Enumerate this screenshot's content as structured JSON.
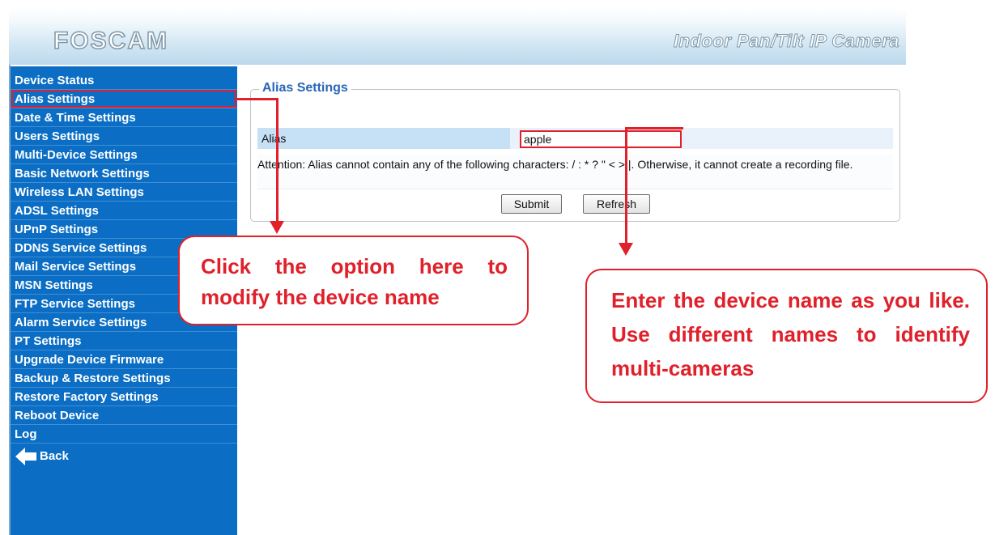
{
  "header": {
    "logo_text": "FOSCAM",
    "product_title": "Indoor Pan/Tilt IP Camera"
  },
  "sidebar": {
    "items": [
      {
        "label": "Device Status"
      },
      {
        "label": "Alias Settings"
      },
      {
        "label": "Date & Time Settings"
      },
      {
        "label": "Users Settings"
      },
      {
        "label": "Multi-Device Settings"
      },
      {
        "label": "Basic Network Settings"
      },
      {
        "label": "Wireless LAN Settings"
      },
      {
        "label": "ADSL Settings"
      },
      {
        "label": "UPnP Settings"
      },
      {
        "label": "DDNS Service Settings"
      },
      {
        "label": "Mail Service Settings"
      },
      {
        "label": "MSN Settings"
      },
      {
        "label": "FTP Service Settings"
      },
      {
        "label": "Alarm Service Settings"
      },
      {
        "label": "PT Settings"
      },
      {
        "label": "Upgrade Device Firmware"
      },
      {
        "label": "Backup & Restore Settings"
      },
      {
        "label": "Restore Factory Settings"
      },
      {
        "label": "Reboot Device"
      },
      {
        "label": "Log"
      }
    ],
    "back_label": "Back",
    "back_icon": "arrow-left-icon",
    "selected": "Alias Settings"
  },
  "alias_settings": {
    "legend": "Alias Settings",
    "alias_label": "Alias",
    "alias_value": "apple",
    "attention": "Attention: Alias cannot contain any of the following characters: / : * ? \" < > |. Otherwise, it cannot create a recording file.",
    "submit_label": "Submit",
    "refresh_label": "Refresh"
  },
  "callouts": {
    "sidebar_hint": "Click the option here to modify the device name",
    "alias_hint": "Enter the device name as you like. Use different names to identify multi-cameras"
  },
  "colors": {
    "sidebar_bg": "#0b6ec4",
    "accent_red": "#e0202a",
    "legend_blue": "#2a66b8",
    "alias_label_bg": "#c6e0f6"
  }
}
